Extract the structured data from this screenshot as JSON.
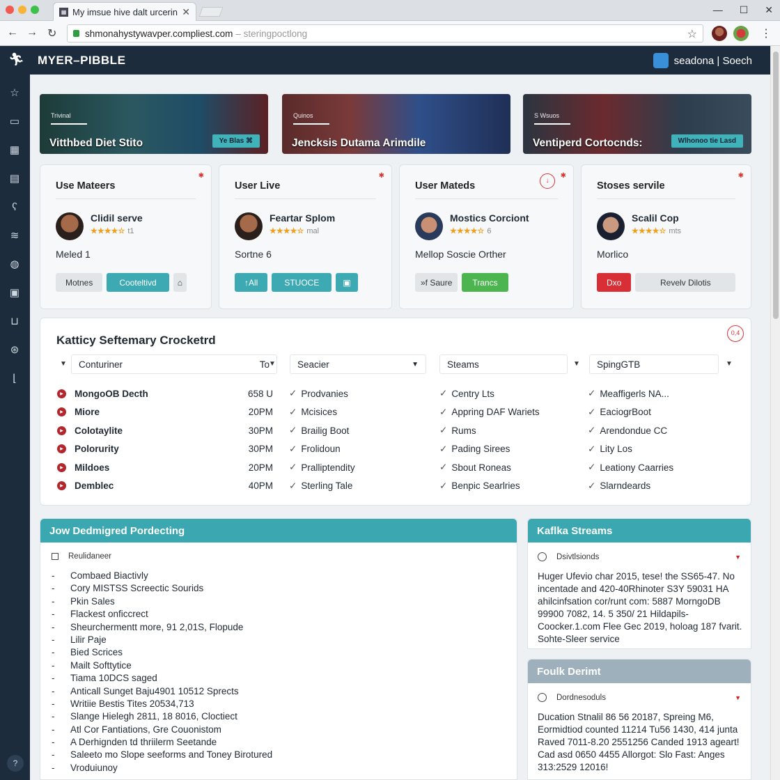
{
  "browser": {
    "tab_title": "My imsue hive dalt urcerins",
    "url_host": "shmonahystywavper.compliest.com",
    "url_rest": "– steringpoctlong"
  },
  "app": {
    "brand": "MYER–PIBBLE",
    "user": "seadona  |  Soech"
  },
  "heroes": [
    {
      "kicker": "Trivinal",
      "title": "Vitthbed Diet Stito",
      "button": "Ye Blas"
    },
    {
      "kicker": "Quinos",
      "title": "Jencksis Dutama Arimdile",
      "button": ""
    },
    {
      "kicker": "S Wsuos",
      "title": "Ventiperd Cortocnds:",
      "button": "Wlhonoo tie Lasd"
    }
  ],
  "cards": [
    {
      "header": "Use Mateers",
      "name": "Clidil serve",
      "rating": "★★★★☆",
      "rating_note": "t1",
      "status": "Meled 1",
      "buttons": [
        "Motnes",
        "Cooteltivd"
      ]
    },
    {
      "header": "User Live",
      "name": "Feartar Splom",
      "rating": "★★★★☆",
      "rating_note": "mal",
      "status": "Sortne  6",
      "buttons": [
        "↑All",
        "STUOCE"
      ]
    },
    {
      "header": "User Mateds",
      "name": "Mostics Corciont",
      "rating": "★★★★☆",
      "rating_note": "6",
      "status": "Mellop Soscie Orther",
      "buttons": [
        "»f Saure",
        "Trancs"
      ]
    },
    {
      "header": "Stoses servile",
      "name": "Scalil Cop",
      "rating": "★★★★☆",
      "rating_note": "mts",
      "status": "Morlico",
      "buttons": [
        "Dxo",
        "Revelv Dilotis"
      ]
    }
  ],
  "panel": {
    "title": "Katticy Seftemary Crocketrd",
    "filters": [
      "Conturiner",
      "To",
      "Seacier",
      "Steams",
      "SpingGTB"
    ],
    "col1": [
      {
        "name": "MongoOB Decth",
        "time": "658 U"
      },
      {
        "name": "Miore",
        "time": "20PM"
      },
      {
        "name": "Colotaylite",
        "time": "30PM"
      },
      {
        "name": "Polorurity",
        "time": "30PM"
      },
      {
        "name": "Mildoes",
        "time": "20PM"
      },
      {
        "name": "Demblec",
        "time": "40PM"
      }
    ],
    "col2": [
      "Prodvanies",
      "Mcisices",
      "Brailig Boot",
      "Frolidoun",
      "Pralliptendity",
      "Sterling Tale"
    ],
    "col3": [
      "Centry Lts",
      "Appring DAF Wariets",
      "Rums",
      "Pading Sirees",
      "Sbout Roneas",
      "Benpic Searlries"
    ],
    "col4": [
      "Meaffigerls NA...",
      "EaciogrBoot",
      "Arendondue CC",
      "Lity Los",
      "Leationy Caarries",
      "Slarndeards"
    ]
  },
  "left_panel": {
    "title": "Jow Dedmigred Pordecting",
    "sub": "Reulidaneer",
    "items": [
      "Combaed Biactivly",
      "Cory MISTSS Screectic Sourids",
      "Pkin Sales",
      "Flackest onficcrect",
      "Sheurchermentt more, 91 2,01S, Flopude",
      "Lilir Paje",
      "Bied Scrices",
      "Mailt Softtytice",
      "Tiama 10DCS saged",
      "Anticall Sunget Baju4901 10512 Sprects",
      "Writiie Bestis Tites 20534,713",
      "Slange Hielegh 2811, 18 8016, Cloctiect",
      "Atl Cor Fantiations, Gre Couonistom",
      "A Derhignden td thriilerm Seetande",
      "Saleeto mo Slope seeforms and Toney Birotured",
      "Vroduiunoy"
    ]
  },
  "right_panels": [
    {
      "title": "Kaflka Streams",
      "sub": "Dsivtlsionds",
      "text": "Huger Ufevio char 2015, tese! the SS65-47. No incentade and 420-40Rhinoter S3Y 59031 HA ahilcinfsation cor/runt com: 5887 MorngoDB 99900 7082, 14. 5 350/ 21 Hildapils-Coocker.1.com Flee Gec 2019, holoag 187 fvarit. Sohte-Sleer service"
    },
    {
      "title": "Foulk Derimt",
      "sub": "Dordnesoduls",
      "text": "Ducation Stnalil 86 56 20187, Spreing M6, Eormidtiod counted 11214 Tu56 1430, 414 junta Raved 7011-8.20 2551256 Canded 1913 ageart! Cad asd 0650 4455 Allorgot: Slo Fast: Anges 313:2529 12016!"
    }
  ]
}
